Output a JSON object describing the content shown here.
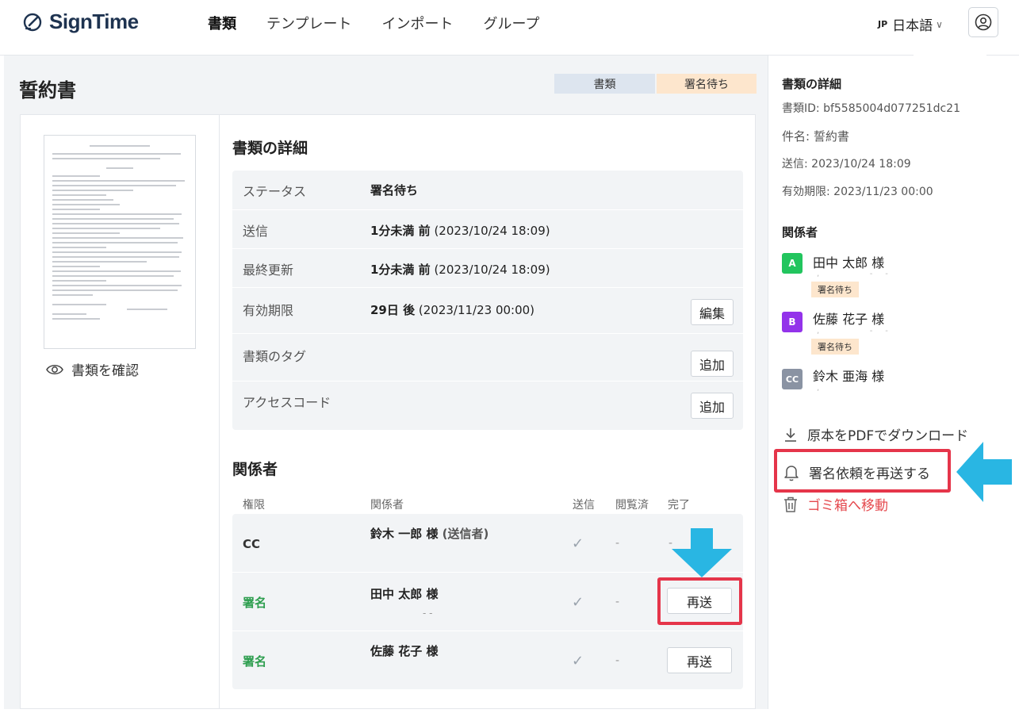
{
  "header": {
    "logo": "SignTime",
    "nav": [
      "書類",
      "テンプレート",
      "インポート",
      "グループ"
    ],
    "lang_code": "JP",
    "lang_label": "日本語"
  },
  "page": {
    "title": "誓約書",
    "tag_doc": "書類",
    "tag_status": "署名待ち",
    "view_doc_label": "書類を確認"
  },
  "details": {
    "section_title": "書類の詳細",
    "rows": [
      {
        "label": "ステータス",
        "value_bold": "署名待ち",
        "value_rest": ""
      },
      {
        "label": "送信",
        "value_bold": "1分未満 前",
        "value_rest": " (2023/10/24 18:09)"
      },
      {
        "label": "最終更新",
        "value_bold": "1分未満 前",
        "value_rest": " (2023/10/24 18:09)"
      },
      {
        "label": "有効期限",
        "value_bold": "29日 後",
        "value_rest": " (2023/11/23 00:00)",
        "button": "編集"
      },
      {
        "label": "書類のタグ",
        "value_bold": "",
        "value_rest": "",
        "button": "追加"
      },
      {
        "label": "アクセスコード",
        "value_bold": "",
        "value_rest": "",
        "button": "追加"
      }
    ]
  },
  "participants": {
    "section_title": "関係者",
    "columns": [
      "権限",
      "関係者",
      "送信",
      "閲覧済",
      "完了"
    ],
    "rows": [
      {
        "role": "CC",
        "name": "鈴木 一郎 様",
        "sender": " (送信者)",
        "check": "✓",
        "viewed": "-",
        "done": "-",
        "button": ""
      },
      {
        "role": "署名",
        "name": "田中 太郎 様",
        "sender": "",
        "check": "✓",
        "viewed": "-",
        "done": "",
        "button": "再送",
        "sub": "-  -"
      },
      {
        "role": "署名",
        "name": "佐藤 花子 様",
        "sender": "",
        "check": "✓",
        "viewed": "-",
        "done": "",
        "button": "再送"
      }
    ]
  },
  "sidebar": {
    "details_title": "書類の詳細",
    "doc_id": "書類ID: bf5585004d077251dc21",
    "subject": "件名: 誓約書",
    "sent": "送信: 2023/10/24 18:09",
    "expiry": "有効期限: 2023/11/23 00:00",
    "participants_title": "関係者",
    "people": [
      {
        "initial": "A",
        "name": "田中 太郎 様",
        "status": "署名待ち",
        "color": "#22c55e"
      },
      {
        "initial": "B",
        "name": "佐藤 花子 様",
        "status": "署名待ち",
        "color": "#9333ea"
      },
      {
        "initial": "CC",
        "name": "鈴木 亜海 様",
        "status": "",
        "color": "#8a93a3"
      }
    ],
    "actions": {
      "download": "原本をPDFでダウンロード",
      "resend": "署名依頼を再送する",
      "trash": "ゴミ箱へ移動"
    }
  },
  "colors": {
    "accent_green": "#2e9e4f",
    "highlight_red": "#e5354a",
    "arrow_blue": "#29b6e3"
  }
}
